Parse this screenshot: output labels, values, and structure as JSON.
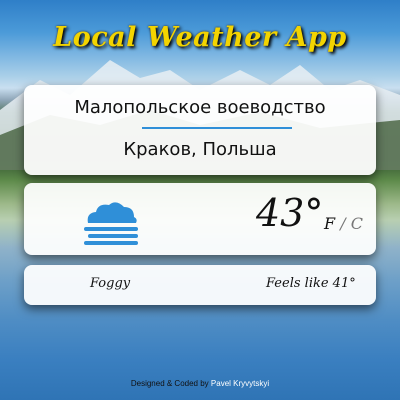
{
  "app": {
    "title": "Local Weather App"
  },
  "location": {
    "region": "Малопольское воеводство",
    "city": "Краков, Польша"
  },
  "weather": {
    "temperature": "43°",
    "unit_f": "F",
    "unit_sep": "/",
    "unit_c": "C",
    "icon": "fog-icon",
    "description": "Foggy",
    "feels_like": "Feels like 41°"
  },
  "footer": {
    "prefix": "Designed & Coded by",
    "author": "Pavel Kryvytskyi"
  },
  "colors": {
    "title": "#f3d400",
    "accent": "#2f8fd8",
    "icon": "#2f8fd8"
  }
}
